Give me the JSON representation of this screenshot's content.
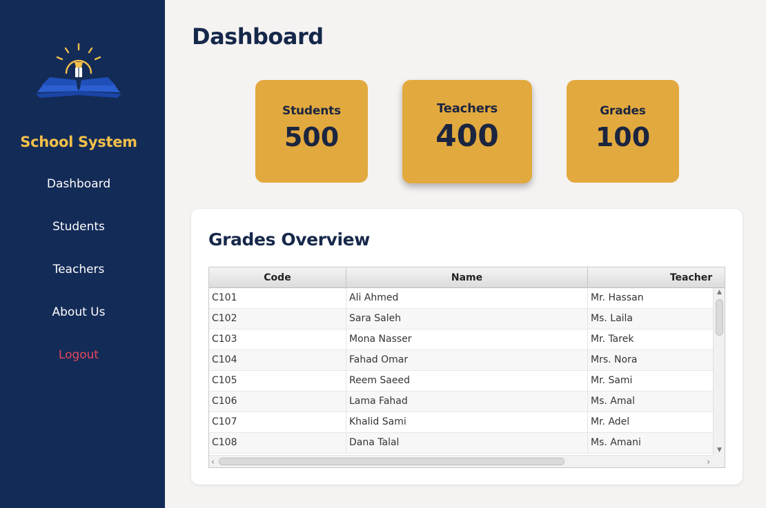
{
  "sidebar": {
    "app_title": "School System",
    "logo_icon": "open-book-lightbulb-logo",
    "nav": [
      {
        "label": "Dashboard"
      },
      {
        "label": "Students"
      },
      {
        "label": "Teachers"
      },
      {
        "label": "About Us"
      },
      {
        "label": "Logout"
      }
    ]
  },
  "page": {
    "title": "Dashboard"
  },
  "stats": {
    "students": {
      "label": "Students",
      "value": "500"
    },
    "teachers": {
      "label": "Teachers",
      "value": "400"
    },
    "grades": {
      "label": "Grades",
      "value": "100"
    }
  },
  "grades_overview": {
    "title": "Grades Overview",
    "columns": [
      "Code",
      "Name",
      "Teacher"
    ],
    "rows": [
      [
        "C101",
        "Ali Ahmed",
        "Mr. Hassan"
      ],
      [
        "C102",
        "Sara Saleh",
        "Ms. Laila"
      ],
      [
        "C103",
        "Mona Nasser",
        "Mr. Tarek"
      ],
      [
        "C104",
        "Fahad Omar",
        "Mrs. Nora"
      ],
      [
        "C105",
        "Reem Saeed",
        "Mr. Sami"
      ],
      [
        "C106",
        "Lama Fahad",
        "Ms. Amal"
      ],
      [
        "C107",
        "Khalid Sami",
        "Mr. Adel"
      ],
      [
        "C108",
        "Dana Talal",
        "Ms. Amani"
      ]
    ]
  },
  "colors": {
    "sidebar_bg": "#132b57",
    "brand_yellow": "#f3c04a",
    "card_bg": "#e2a93e",
    "logout_red": "#e9465c",
    "page_bg": "#f5f3f2"
  }
}
